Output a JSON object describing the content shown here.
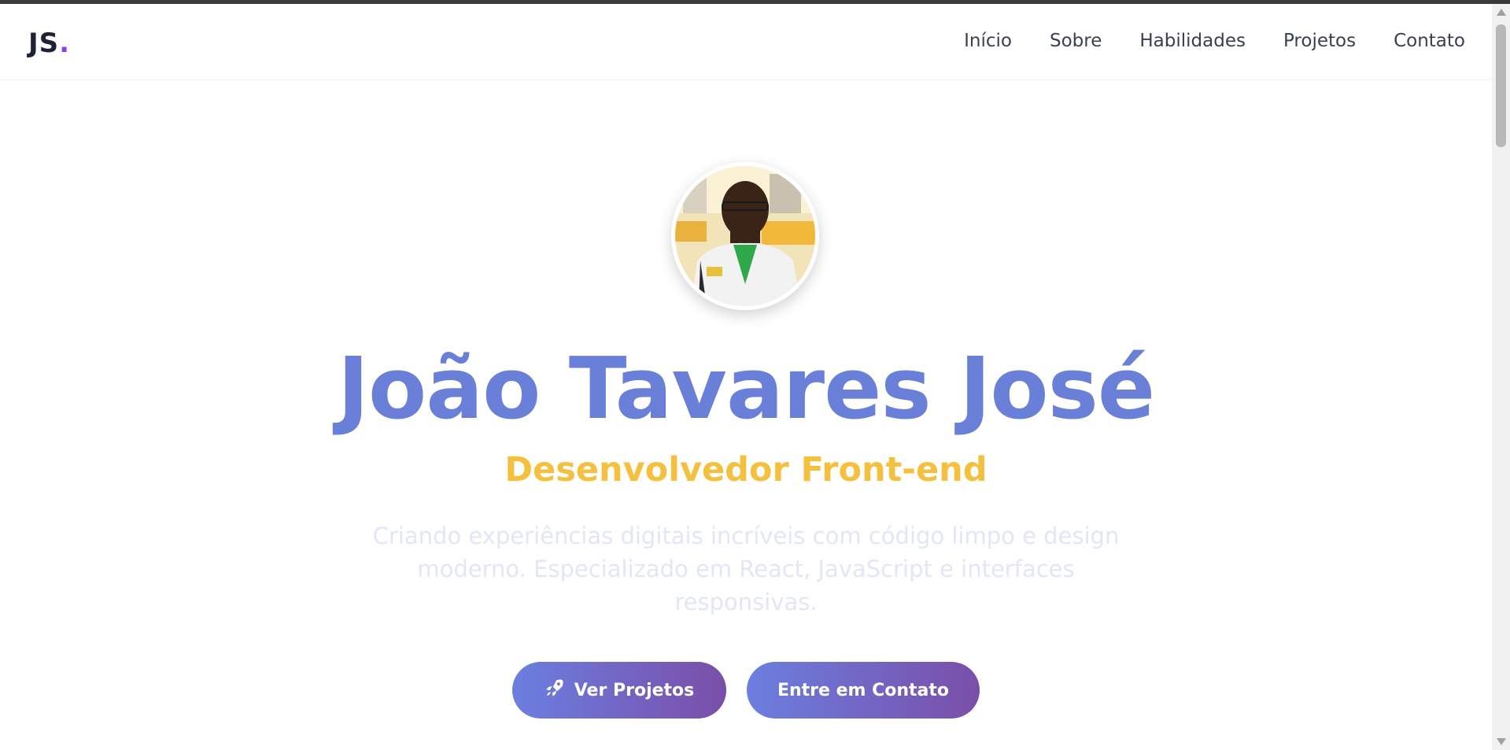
{
  "header": {
    "logo_text": "JS",
    "logo_dot": ".",
    "nav": [
      "Início",
      "Sobre",
      "Habilidades",
      "Projetos",
      "Contato"
    ]
  },
  "hero": {
    "avatar_alt": "João Tavares José",
    "name": "João Tavares José",
    "role": "Desenvolvedor Front-end",
    "description": "Criando experiências digitais incríveis com código limpo e design moderno. Especializado em React, JavaScript e interfaces responsivas.",
    "buttons": {
      "projects_label": "Ver Projetos",
      "projects_icon": "rocket-icon",
      "contact_label": "Entre em Contato"
    }
  },
  "colors": {
    "name": "#6a7fd8",
    "role": "#f4c03d",
    "button_gradient_start": "#6b7fe0",
    "button_gradient_end": "#7a4ea8",
    "logo_dot": "#8b3df0"
  }
}
